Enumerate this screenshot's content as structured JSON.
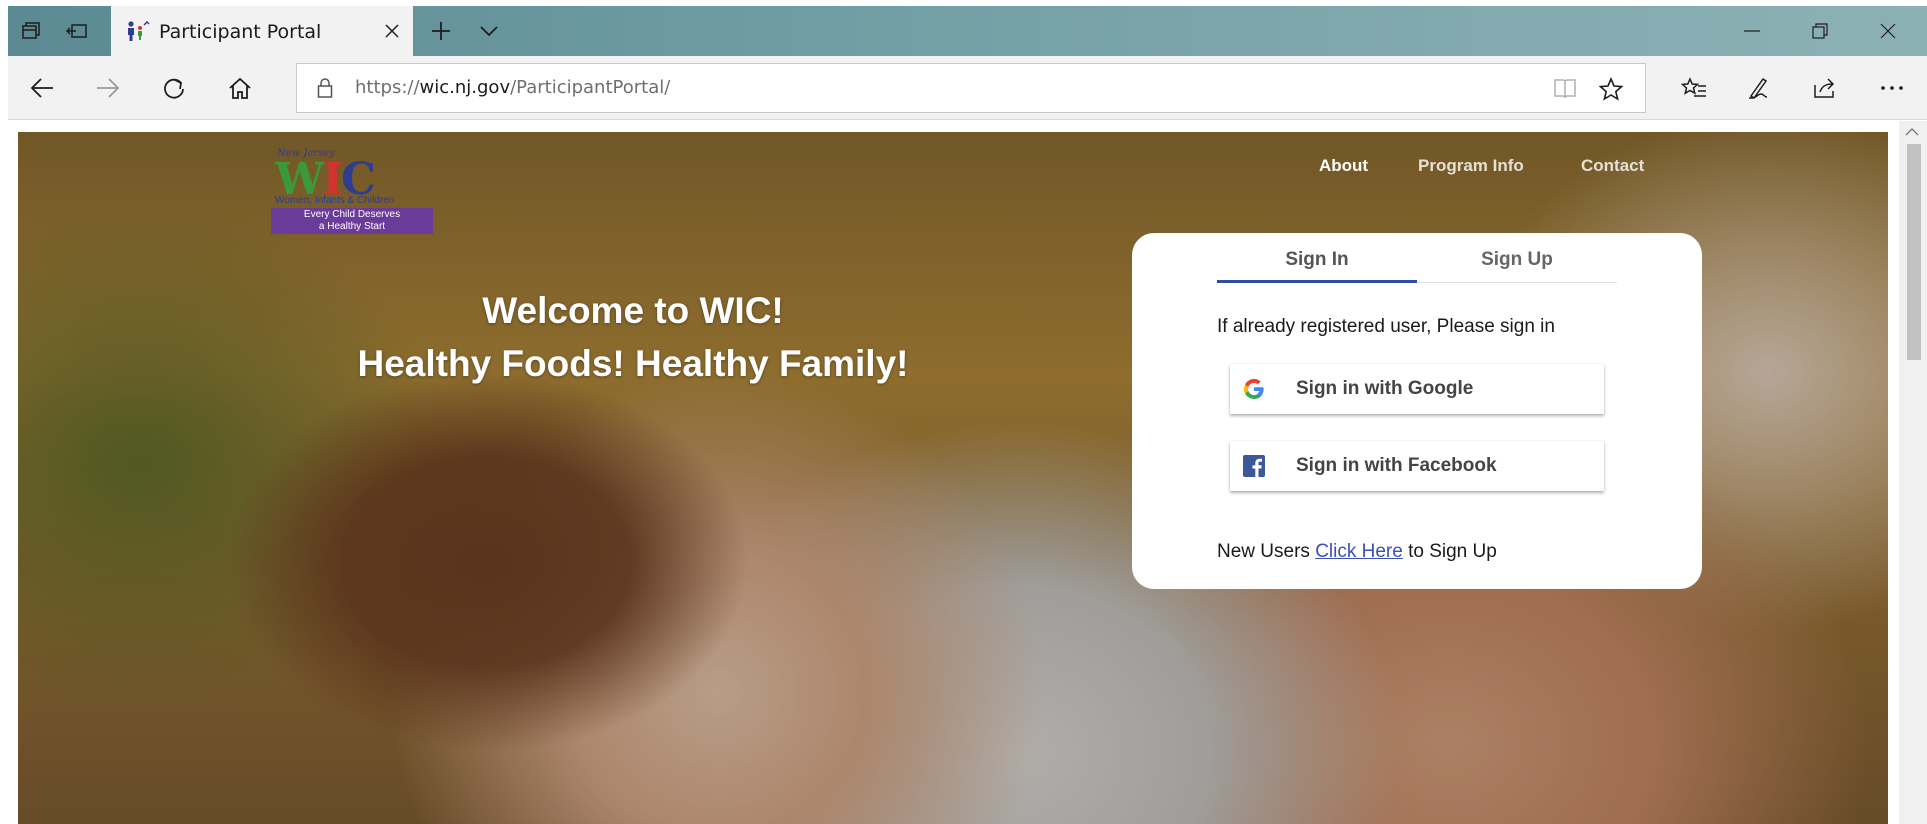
{
  "browser": {
    "tab_title": "Participant Portal",
    "url_scheme": "https://",
    "url_host": "wic.nj.gov",
    "url_path": "/ParticipantPortal/"
  },
  "site": {
    "logo": {
      "top_text": "New Jersey",
      "wordmark": "WIC",
      "tagline": "Women, Infants & Children",
      "band_line1": "Every Child Deserves",
      "band_line2": "a Healthy Start",
      "band_color": "#6b3b9a"
    },
    "nav": {
      "about": "About",
      "program_info": "Program Info",
      "contact": "Contact"
    },
    "hero": {
      "line1": "Welcome to WIC!",
      "line2": "Healthy Foods! Healthy Family!"
    },
    "card": {
      "tab_signin": "Sign In",
      "tab_signup": "Sign Up",
      "hint": "If already registered user, Please sign in",
      "google_label": "Sign in with Google",
      "facebook_label": "Sign in with Facebook",
      "new_users_prefix": "New Users ",
      "click_here": "Click Here",
      "new_users_suffix": " to Sign Up",
      "accent_color": "#2b4fa3"
    }
  }
}
